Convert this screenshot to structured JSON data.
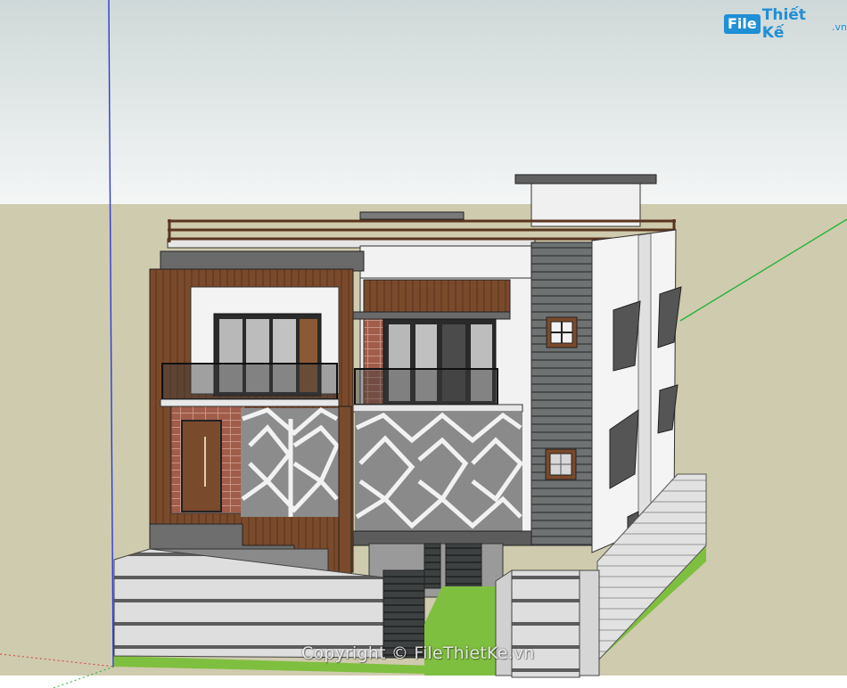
{
  "logo": {
    "box_text": "File",
    "name": "Thiết Kế",
    "tld": ".vn"
  },
  "watermark": {
    "text": "Copyright © FileThietKe.vn"
  },
  "colors": {
    "sky_top": "#cfd8d8",
    "sky_bottom": "#f4f6f6",
    "ground": "#cfcbae",
    "axis_blue": "#2a3bd6",
    "axis_green": "#27b23a",
    "axis_red": "#d04040",
    "wood": "#7a4a2c",
    "brick": "#9c5a48",
    "white_wall": "#f2f2f2",
    "grey_slat": "#6f7272",
    "fence": "#dadada",
    "lawn": "#7fbf3f",
    "brand": "#1f8fd6"
  }
}
